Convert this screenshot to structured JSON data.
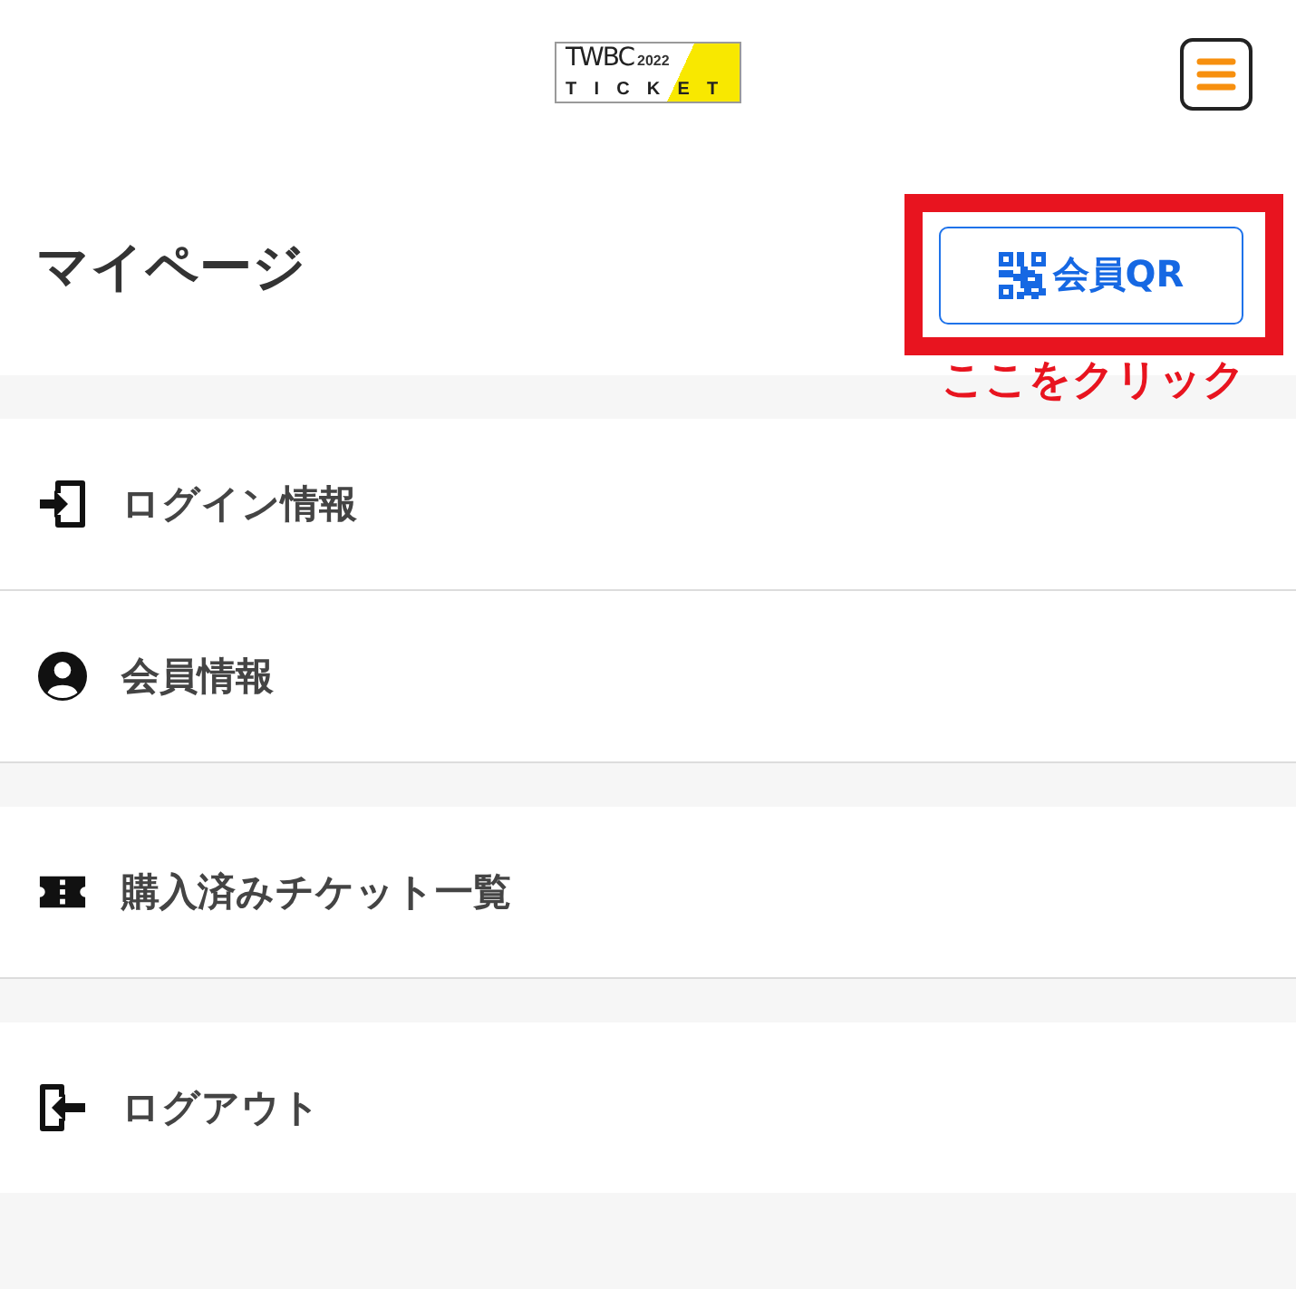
{
  "header": {
    "logo": {
      "title": "TWBC",
      "year": "2022",
      "word": "TICKET"
    }
  },
  "page": {
    "title": "マイページ",
    "qr_button": {
      "label": "会員QR"
    },
    "callout": "ここをクリック"
  },
  "menu_groups": [
    {
      "items": [
        {
          "kind": "login",
          "label": "ログイン情報"
        },
        {
          "kind": "member",
          "label": "会員情報"
        }
      ]
    },
    {
      "items": [
        {
          "kind": "tickets",
          "label": "購入済みチケット一覧"
        }
      ]
    },
    {
      "items": [
        {
          "kind": "logout",
          "label": "ログアウト"
        }
      ]
    }
  ]
}
